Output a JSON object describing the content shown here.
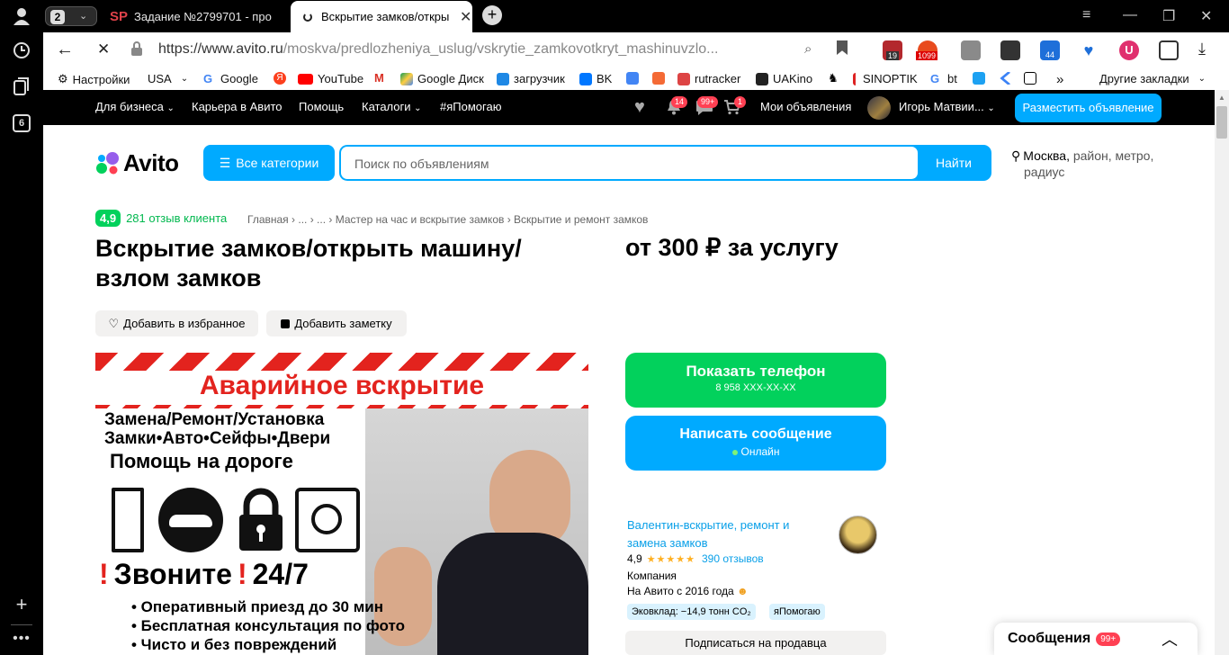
{
  "browser": {
    "tab_count": "2",
    "tabs": [
      {
        "label": "Задание №2799701 - про"
      },
      {
        "label": "Вскрытие замков/откры"
      }
    ],
    "url_domain": "https://www.avito.ru",
    "url_path": "/moskva/predlozheniya_uslug/vskrytie_zamkovotkryt_mashinuvzlo...",
    "side_badge": "6",
    "extensions": [
      {
        "name": "ext-badge-19",
        "label": "19",
        "color": "#b3282d"
      },
      {
        "name": "ext-badge-1099",
        "label": "1099",
        "color": "#e84b1e"
      },
      {
        "name": "ext-badge-44",
        "label": "44",
        "color": "#1e6fd9"
      }
    ],
    "bookmarks": [
      {
        "label": "Настройки"
      },
      {
        "label": "USA"
      },
      {
        "label": "Google"
      },
      {
        "label": "YouTube"
      },
      {
        "label": "Google Диск"
      },
      {
        "label": "загрузчик"
      },
      {
        "label": "BK"
      },
      {
        "label": "rutracker"
      },
      {
        "label": "UAKino"
      },
      {
        "label": "SINOPTIK"
      },
      {
        "label": "bt"
      },
      {
        "label": "Другие закладки"
      }
    ]
  },
  "topbar": {
    "for_business": "Для бизнеса",
    "career": "Карьера в Авито",
    "help": "Помощь",
    "catalogs": "Каталоги",
    "help_tag": "#яПомогаю",
    "notifications_badge": "14",
    "messages_badge": "99+",
    "cart_badge": "1",
    "my_ads": "Мои объявления",
    "user_name": "Игорь Матвии...",
    "post_ad": "Разместить объявление"
  },
  "header": {
    "logo_text": "Avito",
    "all_categories": "Все категории",
    "search_placeholder": "Поиск по объявлениям",
    "search_button": "Найти",
    "location_city": "Москва,",
    "location_rest": "район, метро,",
    "location_radius": "радиус"
  },
  "listing": {
    "rating": "4,9",
    "reviews_link": "281 отзыв клиента",
    "breadcrumb": [
      "Главная",
      "...",
      "...",
      "Мастер на час и вскрытие замков",
      "Вскрытие и ремонт замков"
    ],
    "title_line1": "Вскрытие замков/открыть машину/",
    "title_line2": "взлом замков",
    "price": "от 300 ₽ за услугу",
    "add_favorite": "Добавить в избранное",
    "add_note": "Добавить заметку"
  },
  "photo": {
    "banner": "Аварийное вскрытие",
    "line1": "Замена/Ремонт/Установка",
    "line2": "Замки•Авто•Сейфы•Двери",
    "line3": "Помощь на дороге",
    "call": "Звоните",
    "call_hours": "24/7",
    "bullets": [
      "• Оперативный приезд до 30 мин",
      "• Бесплатная консультация по фото",
      "• Чисто и без повреждений"
    ]
  },
  "actions": {
    "show_phone": "Показать телефон",
    "phone_masked": "8 958 XXX-XX-XX",
    "write_message": "Написать сообщение",
    "online": "Онлайн",
    "subscribe": "Подписаться на продавца"
  },
  "seller": {
    "name_line1": "Валентин-вскрытие, ремонт и",
    "name_line2": "замена замков",
    "rating": "4,9",
    "stars": 5,
    "reviews": "390 отзывов",
    "type": "Компания",
    "since": "На Авито с 2016 года",
    "eco": "Эковклад: −14,9 тонн CO₂",
    "help_tag": "яПомогаю"
  },
  "messenger": {
    "label": "Сообщения",
    "badge": "99+"
  },
  "colors": {
    "avito_blue": "#00aaff",
    "avito_green": "#02d15c",
    "rating_green": "#02d15c",
    "link_blue": "#0aa0e8"
  }
}
